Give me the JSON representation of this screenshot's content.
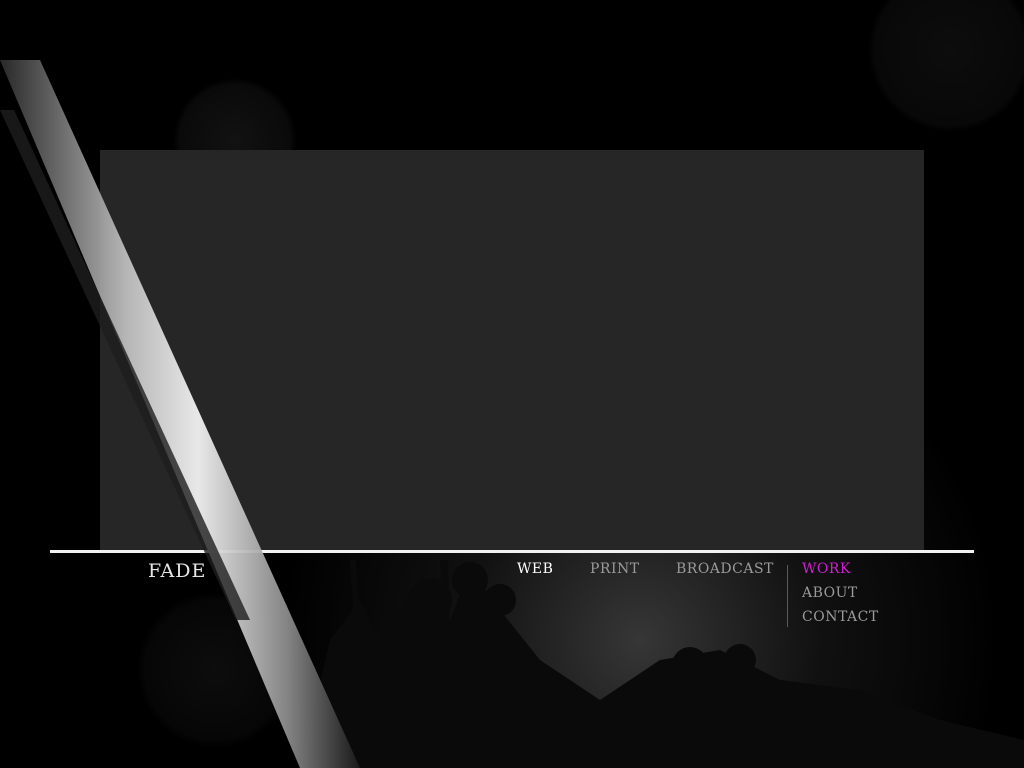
{
  "brand": {
    "logo_text": "FADE"
  },
  "category_nav": {
    "items": [
      {
        "label": "WEB",
        "active": true
      },
      {
        "label": "PRINT",
        "active": false
      },
      {
        "label": "BROADCAST",
        "active": false
      }
    ]
  },
  "main_nav": {
    "items": [
      {
        "label": "WORK",
        "active": true
      },
      {
        "label": "ABOUT",
        "active": false
      },
      {
        "label": "CONTACT",
        "active": false
      }
    ]
  },
  "colors": {
    "background": "#000000",
    "panel": "#262626",
    "divider": "#f2f2f2",
    "nav_text": "#9a9a9a",
    "nav_active_category": "#ffffff",
    "nav_active_main": "#d21ed2"
  }
}
